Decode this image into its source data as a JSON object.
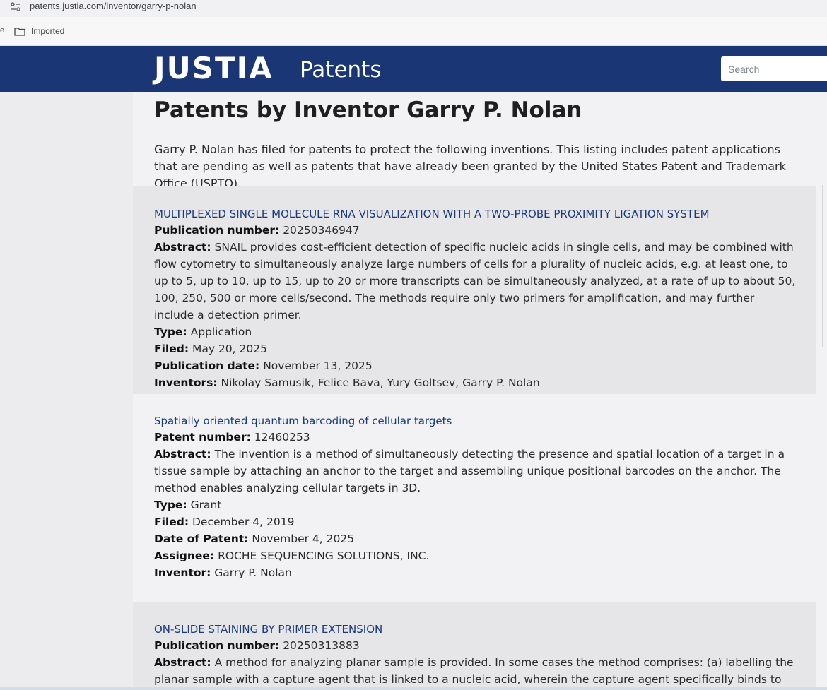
{
  "browser": {
    "url": "patents.justia.com/inventor/garry-p-nolan",
    "bookmark_edge": "e",
    "bookmark_folder": "Imported"
  },
  "header": {
    "logo_main": "JUSTIA",
    "logo_sub": "Patents",
    "search_placeholder": "Search"
  },
  "page": {
    "title": "Patents by Inventor Garry P. Nolan",
    "intro": "Garry P. Nolan has filed for patents to protect the following inventions. This listing includes patent applications that are pending as well as patents that have already been granted by the United States Patent and Trademark Office (USPTO)."
  },
  "entries": [
    {
      "title": "MULTIPLEXED SINGLE MOLECULE RNA VISUALIZATION WITH A TWO-PROBE PROXIMITY LIGATION SYSTEM",
      "fields": [
        {
          "label": "Publication number:",
          "value": "20250346947"
        },
        {
          "label": "Abstract:",
          "value": "SNAIL provides cost-efficient detection of specific nucleic acids in single cells, and may be combined with flow cytometry to simultaneously analyze large numbers of cells for a plurality of nucleic acids, e.g. at least one, to up to 5, up to 10, up to 15, up to 20 or more transcripts can be simultaneously analyzed, at a rate of up to about 50, 100, 250, 500 or more cells/second. The methods require only two primers for amplification, and may further include a detection primer."
        },
        {
          "label": "Type:",
          "value": "Application"
        },
        {
          "label": "Filed:",
          "value": "May 20, 2025"
        },
        {
          "label": "Publication date:",
          "value": "November 13, 2025"
        },
        {
          "label": "Inventors:",
          "value": "Nikolay Samusik, Felice Bava, Yury Goltsev, Garry P. Nolan"
        }
      ]
    },
    {
      "title": "Spatially oriented quantum barcoding of cellular targets",
      "fields": [
        {
          "label": "Patent number:",
          "value": "12460253"
        },
        {
          "label": "Abstract:",
          "value": "The invention is a method of simultaneously detecting the presence and spatial location of a target in a tissue sample by attaching an anchor to the target and assembling unique positional barcodes on the anchor. The method enables analyzing cellular targets in 3D."
        },
        {
          "label": "Type:",
          "value": "Grant"
        },
        {
          "label": "Filed:",
          "value": "December 4, 2019"
        },
        {
          "label": "Date of Patent:",
          "value": "November 4, 2025"
        },
        {
          "label": "Assignee:",
          "value": "ROCHE SEQUENCING SOLUTIONS, INC."
        },
        {
          "label": "Inventor:",
          "value": "Garry P. Nolan"
        }
      ]
    },
    {
      "title": "ON-SLIDE STAINING BY PRIMER EXTENSION",
      "fields": [
        {
          "label": "Publication number:",
          "value": "20250313883"
        },
        {
          "label": "Abstract:",
          "value": "A method for analyzing planar sample is provided. In some cases the method comprises: (a) labelling the planar sample with a capture agent that is linked to a nucleic acid, wherein the capture agent specifically binds to"
        }
      ]
    }
  ]
}
